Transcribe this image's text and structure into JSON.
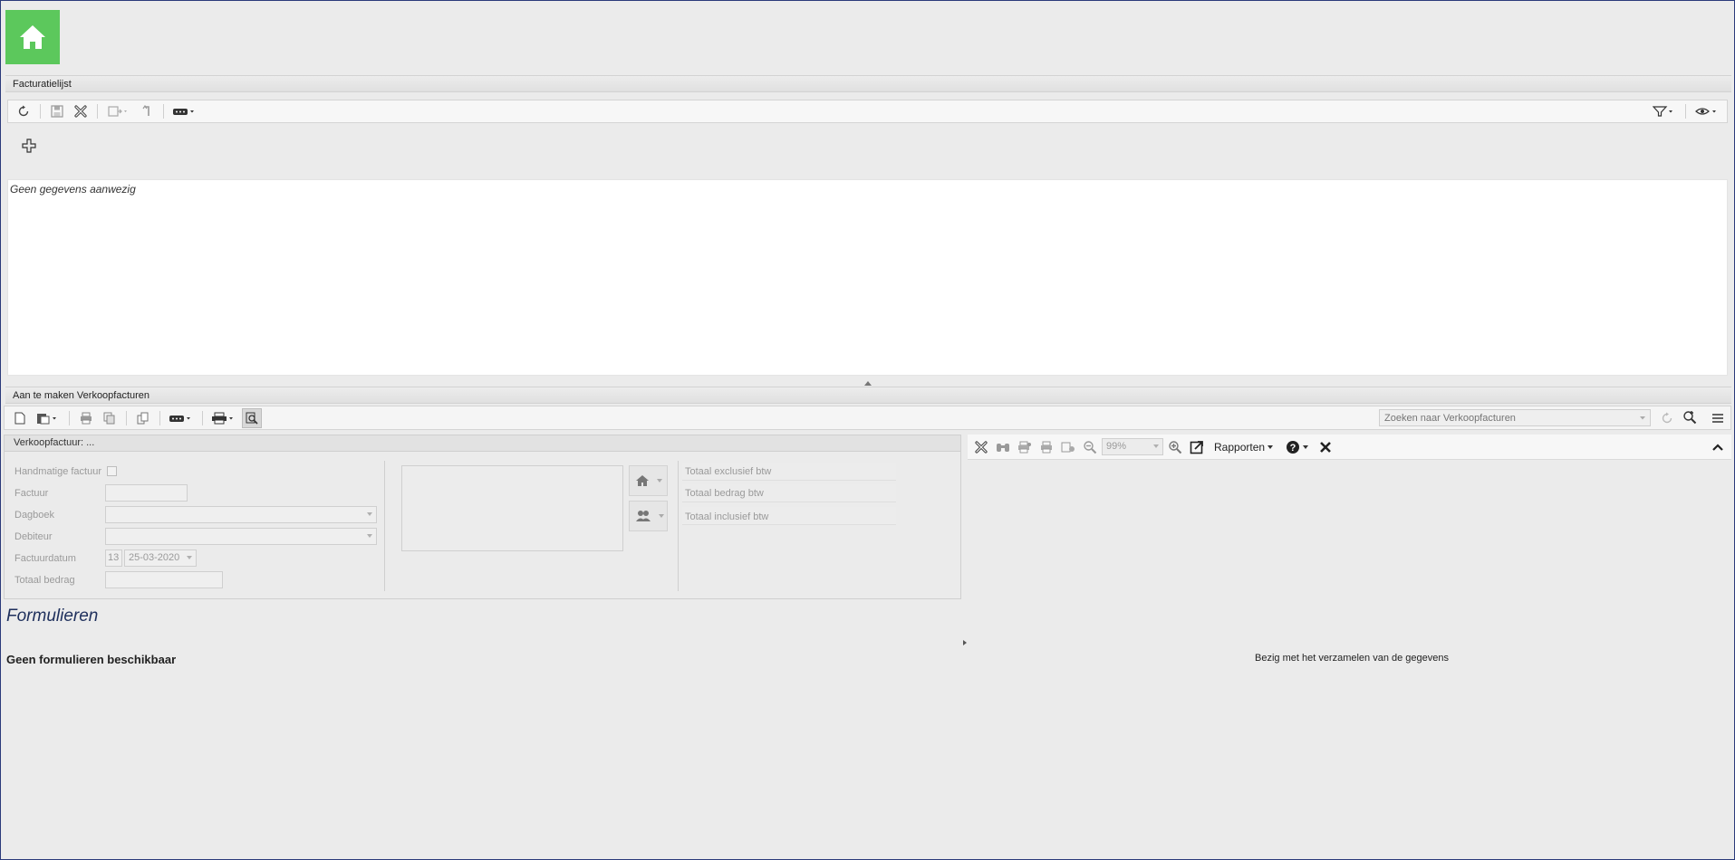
{
  "list_section": {
    "title": "Facturatielijst",
    "empty_text": "Geen gegevens aanwezig"
  },
  "invoice_section": {
    "title": "Aan te maken Verkoopfacturen",
    "search_placeholder": "Zoeken naar Verkoopfacturen"
  },
  "invoice_form": {
    "title": "Verkoopfactuur: ...",
    "labels": {
      "manual": "Handmatige factuur",
      "invoice": "Factuur",
      "journal": "Dagboek",
      "debtor": "Debiteur",
      "invoice_date": "Factuurdatum",
      "total_amount": "Totaal bedrag"
    },
    "date_day": "13",
    "date_value": "25-03-2020",
    "totals": {
      "excl": "Totaal exclusief btw",
      "vat": "Totaal bedrag btw",
      "incl": "Totaal inclusief btw"
    }
  },
  "report_viewer": {
    "zoom": "99%",
    "reports_label": "Rapporten",
    "loading_text": "Bezig met het verzamelen van de gegevens"
  },
  "forms_section": {
    "title": "Formulieren",
    "empty_text": "Geen formulieren beschikbaar"
  },
  "colors": {
    "home_tile": "#5cc85c",
    "heading_blue": "#1e2f5c"
  }
}
